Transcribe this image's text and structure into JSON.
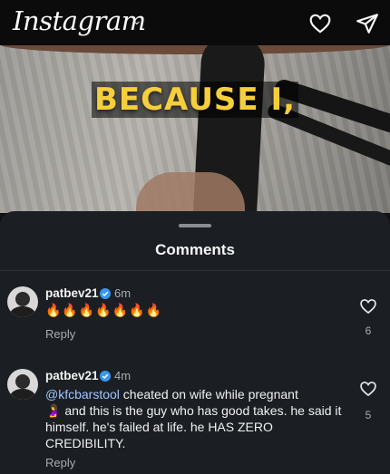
{
  "app": {
    "logo_text": "Instagram",
    "logo_chevron": "⌄"
  },
  "top_actions": [
    {
      "icon": "heart-icon"
    },
    {
      "icon": "send-icon"
    }
  ],
  "video": {
    "caption": "BECAUSE I,"
  },
  "sheet": {
    "title": "Comments"
  },
  "comments": [
    {
      "username": "patbev21",
      "verified": true,
      "time": "6m",
      "body_emoji": "🔥🔥🔥🔥🔥🔥🔥",
      "reply_label": "Reply",
      "likes": "6"
    },
    {
      "username": "patbev21",
      "verified": true,
      "time": "4m",
      "mention": "@kfcbarstool",
      "text_line1": " cheated on wife while pregnant",
      "emoji": "🤰",
      "text_rest": " and this is the guy who has good takes. he said it himself. he's failed at life. he HAS ZERO CREDIBILITY.",
      "reply_label": "Reply",
      "likes": "5"
    }
  ],
  "colors": {
    "background": "#101214",
    "sheet": "#1b1f23",
    "caption": "#f5cf3b",
    "mention": "#9ec5ff",
    "verified": "#3897f0"
  }
}
